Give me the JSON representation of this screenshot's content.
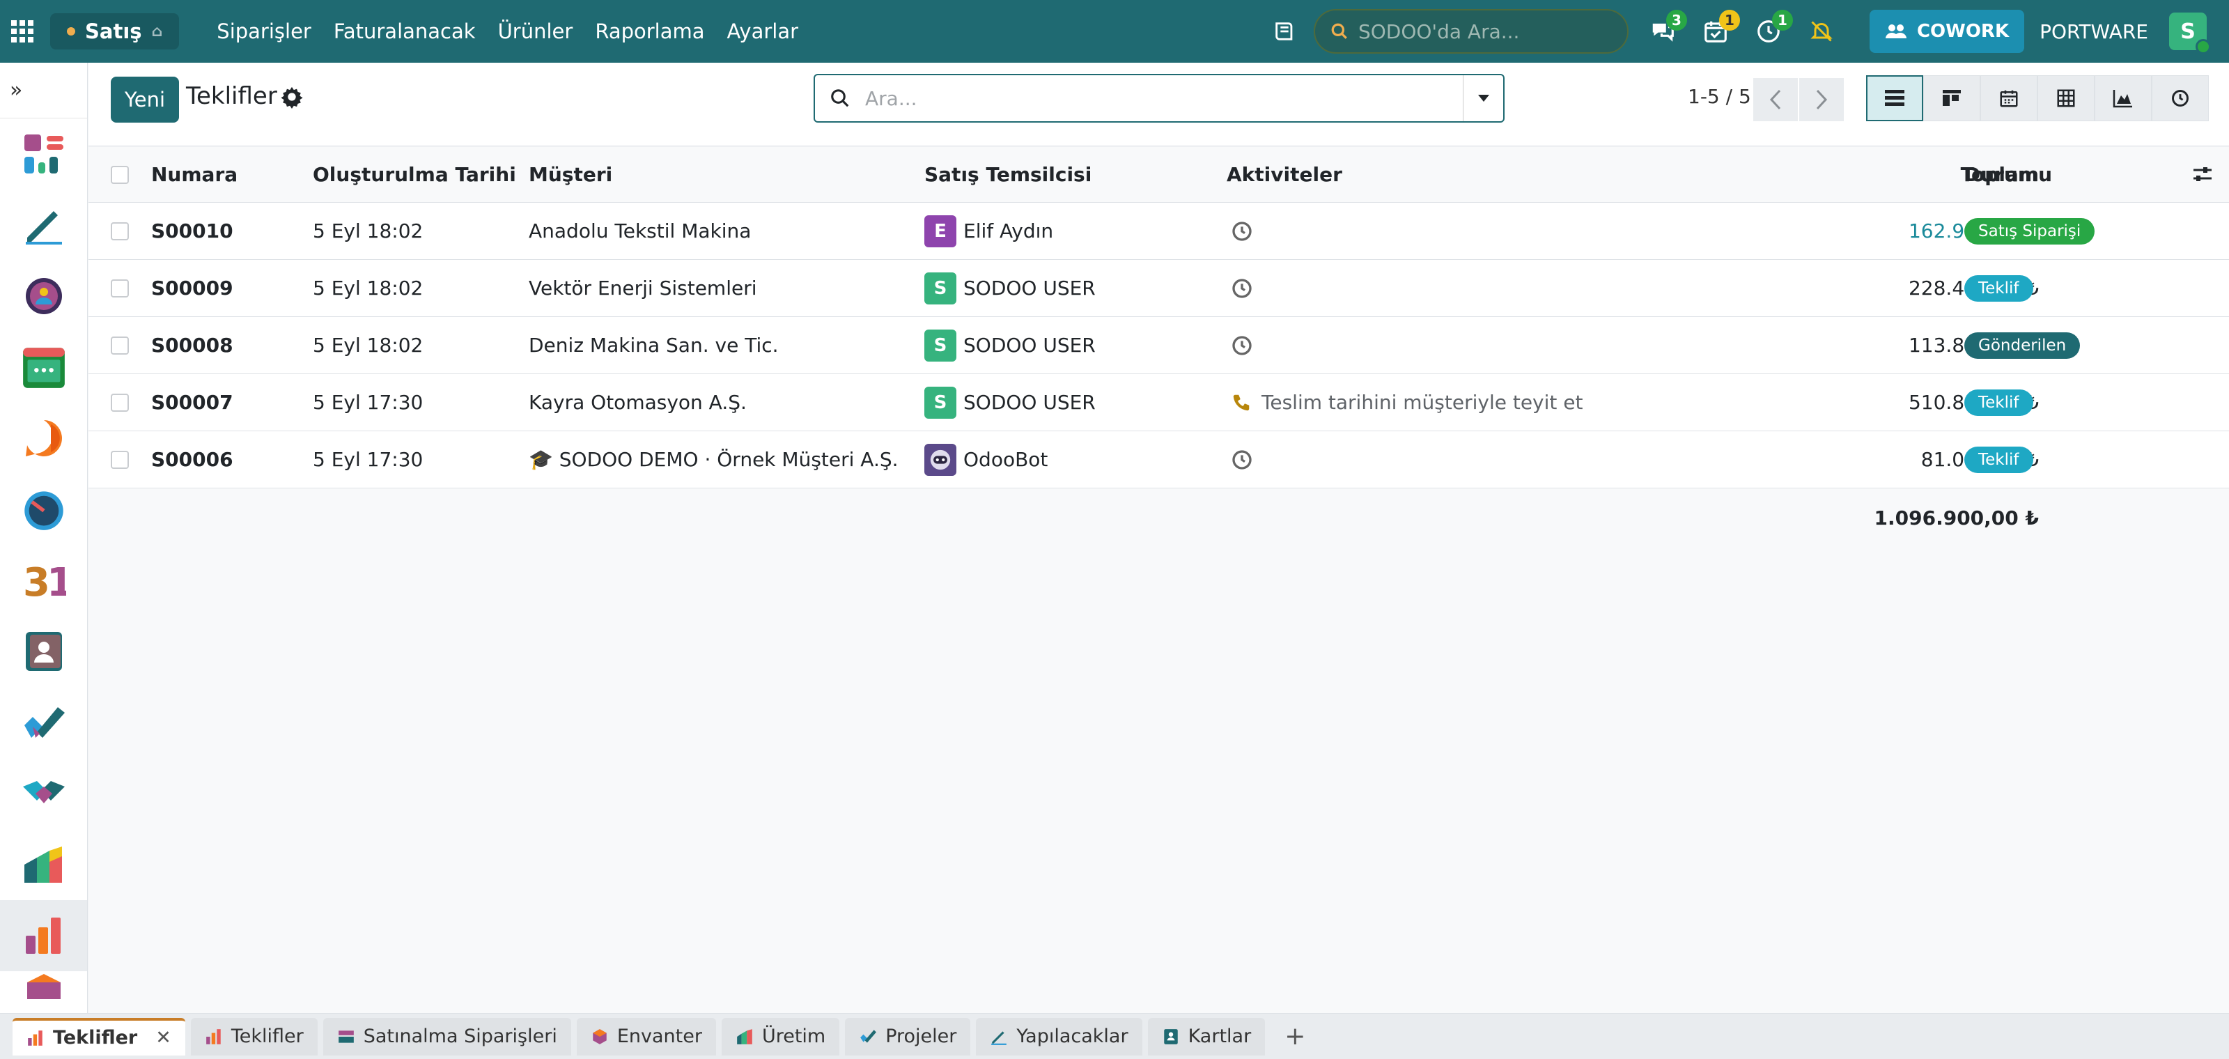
{
  "topbar": {
    "app_name": "Satış",
    "menu": [
      "Siparişler",
      "Faturalanacak",
      "Ürünler",
      "Raporlama",
      "Ayarlar"
    ],
    "search_placeholder": "SODOO'da Ara...",
    "badges": {
      "messages": "3",
      "activities": "1",
      "timer": "1"
    },
    "cowork_label": "COWORK",
    "company": "PORTWARE",
    "user_initial": "S"
  },
  "control_panel": {
    "new_button": "Yeni",
    "title": "Teklifler",
    "search_placeholder": "Ara...",
    "pager": "1-5 / 5"
  },
  "table": {
    "headers": {
      "number": "Numara",
      "created": "Oluşturulma Tarihi",
      "customer": "Müşteri",
      "rep": "Satış Temsilcisi",
      "activities": "Aktiviteler",
      "total": "Toplam",
      "status": "Durumu"
    },
    "rows": [
      {
        "number": "S00010",
        "created": "5 Eyl 18:02",
        "customer": "Anadolu Tekstil Makina",
        "rep_initial": "E",
        "rep": "Elif Aydın",
        "activity": "",
        "total": "162.900,00 ₺",
        "status": "Satış Siparişi"
      },
      {
        "number": "S00009",
        "created": "5 Eyl 18:02",
        "customer": "Vektör Enerji Sistemleri",
        "rep_initial": "S",
        "rep": "SODOO USER",
        "activity": "",
        "total": "228.400,00 ₺",
        "status": "Teklif"
      },
      {
        "number": "S00008",
        "created": "5 Eyl 18:02",
        "customer": "Deniz Makina San. ve Tic.",
        "rep_initial": "S",
        "rep": "SODOO USER",
        "activity": "",
        "total": "113.800,00 ₺",
        "status": "Gönderilen"
      },
      {
        "number": "S00007",
        "created": "5 Eyl 17:30",
        "customer": "Kayra Otomasyon A.Ş.",
        "rep_initial": "S",
        "rep": "SODOO USER",
        "activity": "Teslim tarihini müşteriyle teyit et",
        "total": "510.800,00 ₺",
        "status": "Teklif"
      },
      {
        "number": "S00006",
        "created": "5 Eyl 17:30",
        "customer": "🎓 SODOO DEMO · Örnek Müşteri A.Ş.",
        "rep_initial": "",
        "rep": "OdooBot",
        "activity": "",
        "total": "81.000,00 ₺",
        "status": "Teklif"
      }
    ],
    "grand_total": "1.096.900,00 ₺"
  },
  "bottom_tabs": [
    "Teklifler",
    "Teklifler",
    "Satınalma Siparişleri",
    "Envanter",
    "Üretim",
    "Projeler",
    "Yapılacaklar",
    "Kartlar"
  ],
  "colors": {
    "brand": "#1f6a72",
    "status_sale_order": "#28a745",
    "status_quote": "#1ea8c4",
    "status_sent": "#1f6a72",
    "total_highlight": "#1a8a9a"
  }
}
